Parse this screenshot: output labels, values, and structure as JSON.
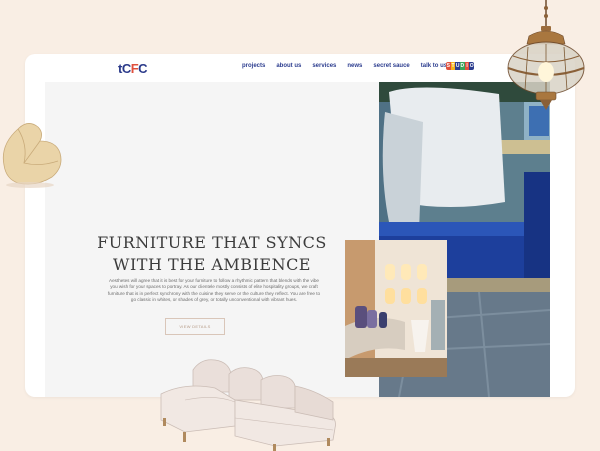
{
  "brand": {
    "logo_main": "tC",
    "logo_accent": "F",
    "logo_end": "C"
  },
  "nav": {
    "links": [
      "projects",
      "about us",
      "services",
      "news",
      "secret sauce",
      "talk to us"
    ],
    "studio_badge": "STUDIO"
  },
  "hero": {
    "headline_line1": "FURNITURE THAT SYNCS",
    "headline_line2": "WITH THE AMBIENCE",
    "body": "Aesthetes will agree that it is best for your furniture to follow a rhythmic pattern that blends with the vibe you wish for your spaces to portray. As our clientele mostly consists of elite hospitality groups, we craft furniture that is in perfect synchrony with the cuisine they serve or the culture they reflect. You are free to go classic in whites, or shades of grey, or totally unconventional with vibrant hues.",
    "cta_label": "VIEW DETAILS"
  },
  "colors": {
    "page_bg": "#f9eee4",
    "brand_blue": "#2c3d8f",
    "brand_red": "#e0503d",
    "sofa_blue": "#1d3f9c"
  },
  "icons": [
    "pendant-lamp-icon",
    "bean-bag-icon",
    "sectional-sofa-icon"
  ]
}
